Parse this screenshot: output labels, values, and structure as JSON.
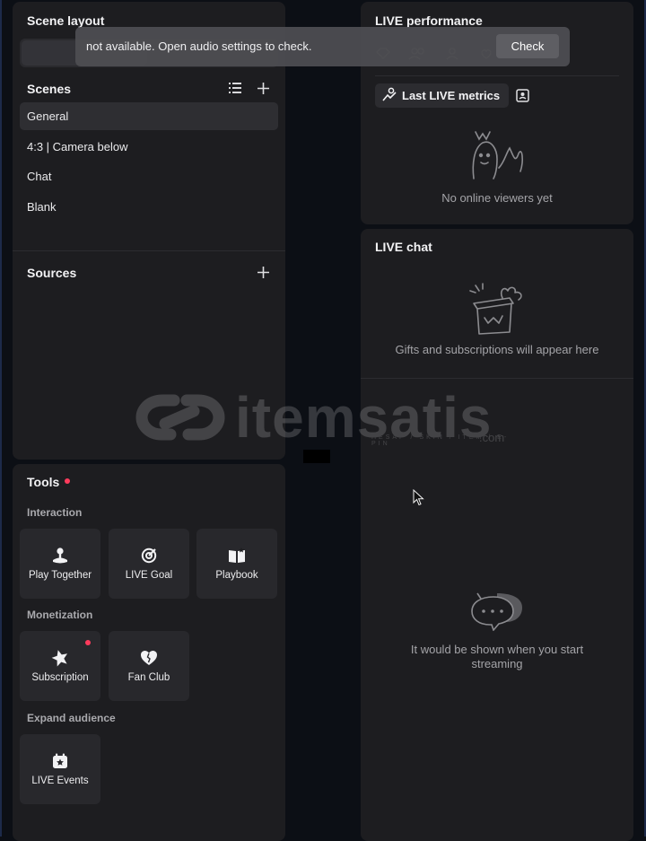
{
  "scene_layout": {
    "title": "Scene layout"
  },
  "scenes": {
    "title": "Scenes",
    "items": [
      {
        "label": "General"
      },
      {
        "label": "4:3 | Camera below"
      },
      {
        "label": "Chat"
      },
      {
        "label": "Blank"
      }
    ]
  },
  "sources": {
    "title": "Sources"
  },
  "tools": {
    "title": "Tools",
    "interaction": {
      "label": "Interaction",
      "items": [
        {
          "label": "Play Together",
          "icon": "joystick-icon"
        },
        {
          "label": "LIVE Goal",
          "icon": "goal-icon"
        },
        {
          "label": "Playbook",
          "icon": "playbook-icon"
        }
      ]
    },
    "monetization": {
      "label": "Monetization",
      "items": [
        {
          "label": "Subscription",
          "icon": "star-badge-icon"
        },
        {
          "label": "Fan Club",
          "icon": "heart-icon"
        }
      ]
    },
    "expand": {
      "label": "Expand audience",
      "items": [
        {
          "label": "LIVE Events",
          "icon": "calendar-star-icon"
        }
      ]
    }
  },
  "live_performance": {
    "title": "LIVE performance",
    "metrics_chip": "Last LIVE metrics",
    "empty_text": "No online viewers yet"
  },
  "live_chat": {
    "title": "LIVE chat",
    "gifts_text": "Gifts and subscriptions will appear here",
    "chat_empty_text": "It would be shown when you start streaming"
  },
  "toast": {
    "message": "not available. Open audio settings to check.",
    "button": "Check"
  },
  "watermark": {
    "text": "itemsatis",
    "sub": "HESAP / SKIN / ITEM / E-PIN",
    "suffix": ".com"
  },
  "colors": {
    "panel": "#1d1d20",
    "background": "#0c0f15",
    "accent_red": "#ff3b5c"
  }
}
